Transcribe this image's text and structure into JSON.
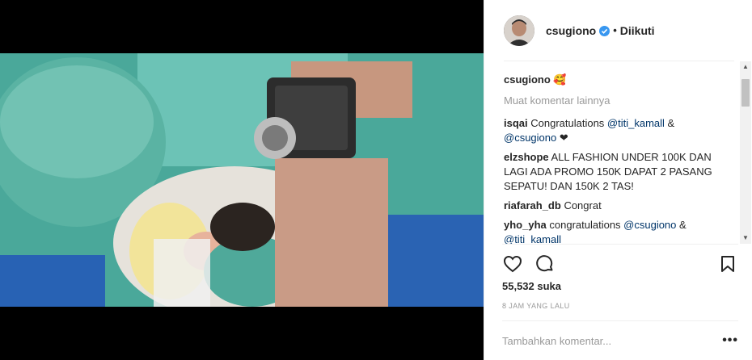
{
  "post": {
    "username": "csugiono",
    "separator": "•",
    "follow_status": "Diikuti",
    "caption_author": "csugiono",
    "caption_emoji": "🥰",
    "load_more": "Muat komentar lainnya",
    "comments": [
      {
        "author": "isqai",
        "parts": [
          "Congratulations ",
          "@titi_kamall",
          " & ",
          "@csugiono",
          " ❤"
        ]
      },
      {
        "author": "elzshope",
        "parts": [
          "ALL FASHION UNDER 100K DAN LAGI ADA PROMO 150K DAPAT 2 PASANG SEPATU! DAN 150K 2 TAS!"
        ]
      },
      {
        "author": "riafarah_db",
        "parts": [
          "Congrat"
        ]
      },
      {
        "author": "yho_yha",
        "parts": [
          "congratulations ",
          "@csugiono",
          " & ",
          "@titi_kamall"
        ]
      }
    ],
    "likes": "55,532 suka",
    "time": "8 JAM YANG LALU",
    "add_comment_placeholder": "Tambahkan komentar...",
    "more_options": "•••"
  },
  "icons": {
    "verified": "verified-badge-icon",
    "like": "heart-icon",
    "comment": "comment-bubble-icon",
    "save": "bookmark-icon"
  },
  "colors": {
    "link": "#003569",
    "verified": "#3897f0",
    "muted": "#999999"
  }
}
